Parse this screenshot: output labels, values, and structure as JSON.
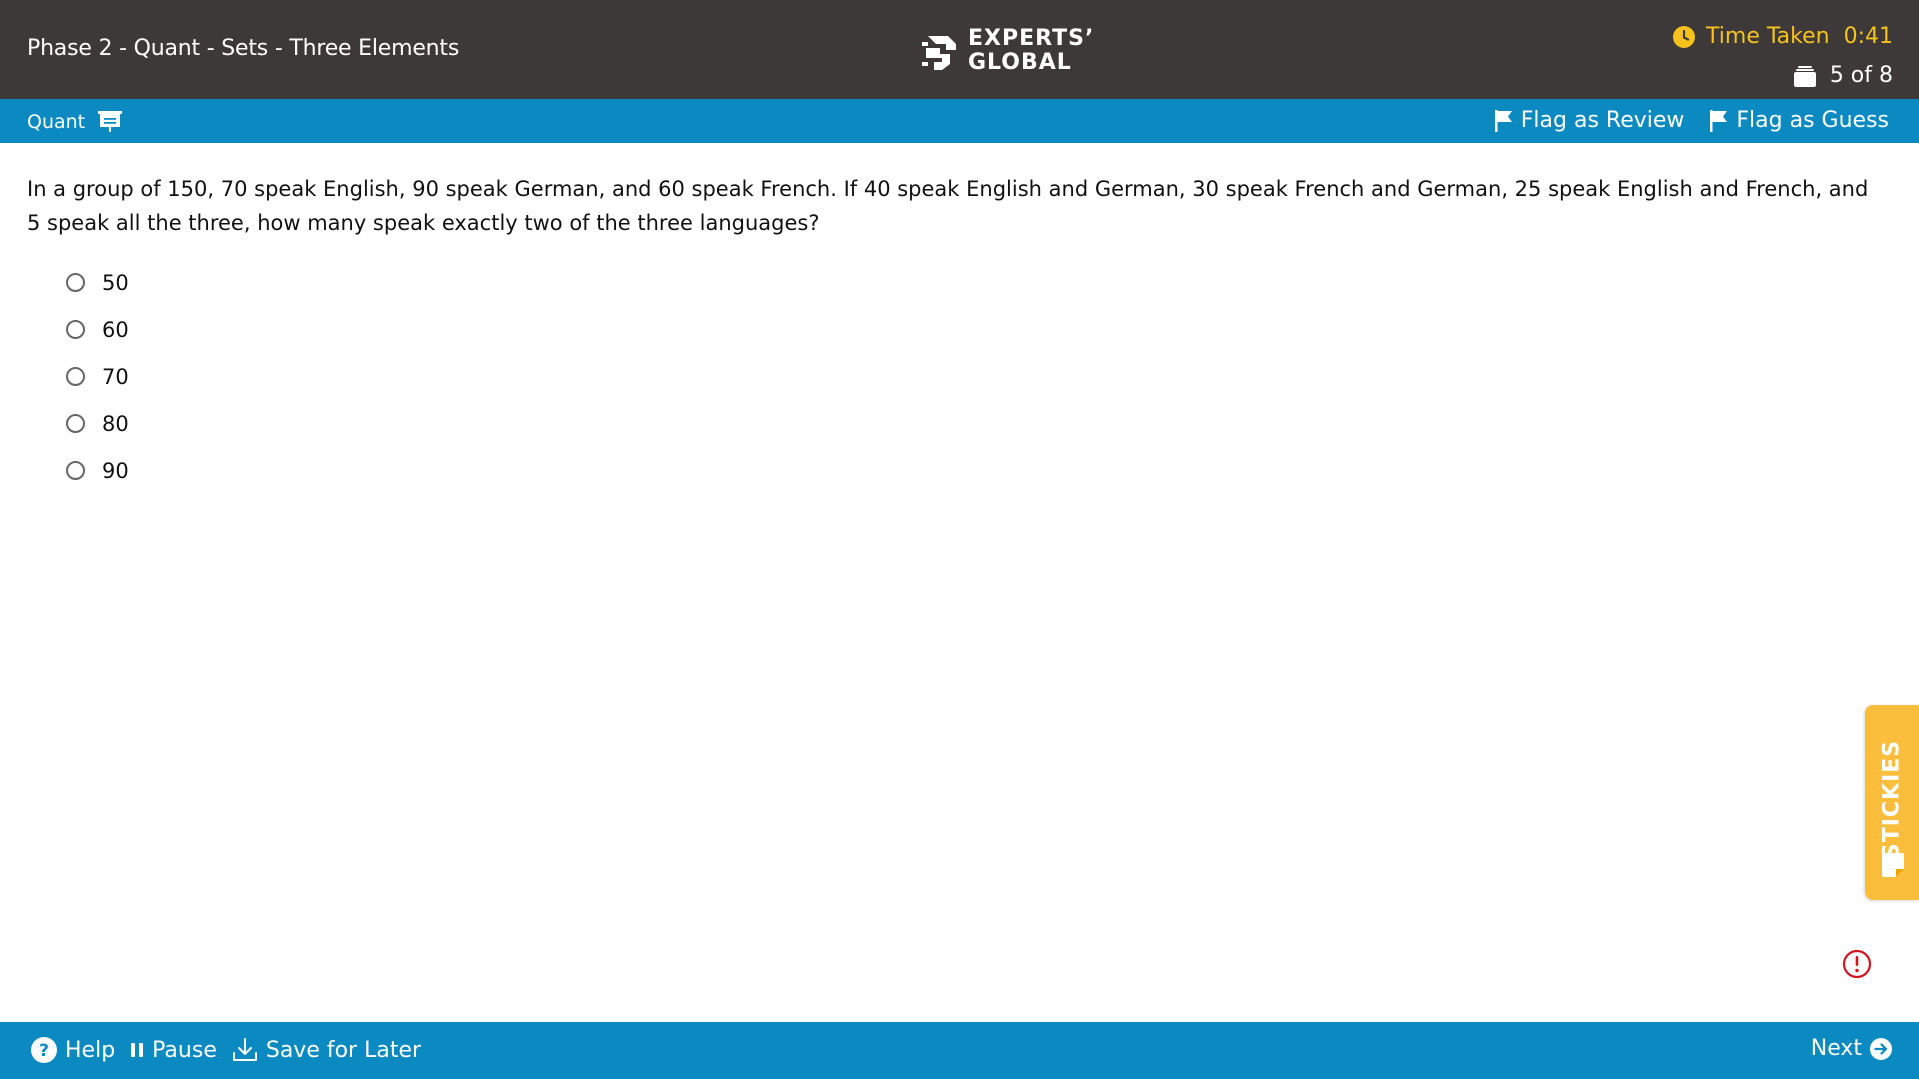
{
  "header": {
    "title": "Phase 2 - Quant - Sets - Three Elements",
    "logo_line1": "EXPERTS’",
    "logo_line2": "GLOBAL",
    "timer_label": "Time Taken",
    "timer_value": "0:41",
    "progress": "5 of 8",
    "accent_color": "#f6c21c"
  },
  "subbar": {
    "section": "Quant",
    "flag_review": "Flag as Review",
    "flag_guess": "Flag as Guess"
  },
  "question": {
    "text": "In a group of 150, 70 speak English, 90 speak German, and 60 speak French. If 40 speak English and German, 30 speak French and German, 25 speak English and French, and 5 speak all the three, how many speak exactly two of the three languages?",
    "options": [
      "50",
      "60",
      "70",
      "80",
      "90"
    ]
  },
  "stickies": {
    "label": "STICKIES"
  },
  "footer": {
    "help": "Help",
    "pause": "Pause",
    "save": "Save for Later",
    "next": "Next"
  },
  "colors": {
    "header_bg": "#3d3938",
    "bar_bg": "#0b8ac2",
    "stickies_bg": "#fbbd3c",
    "alert": "#d0161f"
  }
}
